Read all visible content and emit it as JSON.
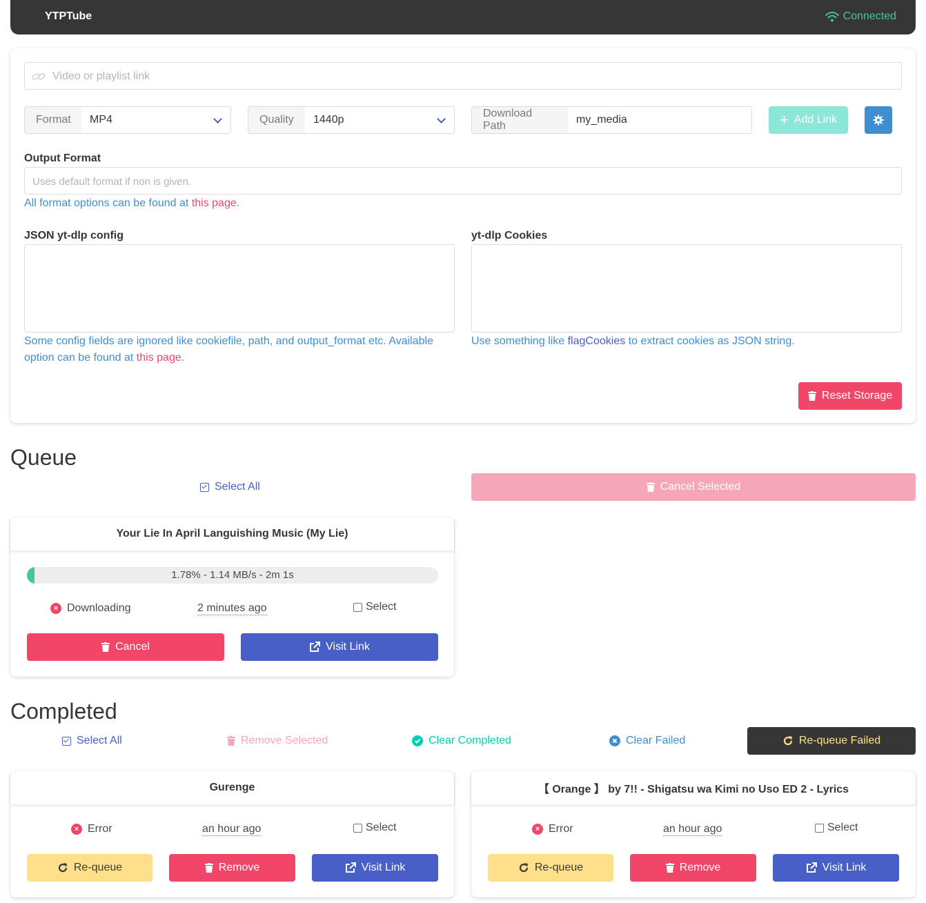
{
  "navbar": {
    "brand": "YTPTube",
    "status": "Connected"
  },
  "form": {
    "url_placeholder": "Video or playlist link",
    "format_label": "Format",
    "format_value": "MP4",
    "quality_label": "Quality",
    "quality_value": "1440p",
    "path_label": "Download Path",
    "path_value": "my_media",
    "add_label": "Add Link",
    "output_label": "Output Format",
    "output_placeholder": "Uses default format if non is given.",
    "output_help_prefix": "All format options can be found at ",
    "output_help_link": "this page",
    "output_help_suffix": ".",
    "config_label": "JSON yt-dlp config",
    "config_help_prefix": "Some config fields are ignored like cookiefile, path, and output_format etc. Available option can be found at ",
    "config_help_link": "this page",
    "config_help_suffix": ".",
    "cookies_label": "yt-dlp Cookies",
    "cookies_help_prefix": "Use something like ",
    "cookies_help_link": "flagCookies",
    "cookies_help_suffix": " to extract cookies as JSON string.",
    "reset_label": "Reset Storage"
  },
  "queue": {
    "title": "Queue",
    "select_all": "Select All",
    "cancel_selected": "Cancel Selected",
    "items": [
      {
        "title": "Your Lie In April Languishing Music (My Lie)",
        "progress": 1.78,
        "progress_text": "1.78% - 1.14 MB/s - 2m 1s",
        "status": "Downloading",
        "time": "2 minutes ago",
        "select": "Select",
        "cancel": "Cancel",
        "visit": "Visit Link"
      }
    ]
  },
  "completed": {
    "title": "Completed",
    "select_all": "Select All",
    "remove_selected": "Remove Selected",
    "clear_completed": "Clear Completed",
    "clear_failed": "Clear Failed",
    "requeue_failed": "Re-queue Failed",
    "items": [
      {
        "title": "Gurenge",
        "status": "Error",
        "time": "an hour ago",
        "select": "Select",
        "requeue": "Re-queue",
        "remove": "Remove",
        "visit": "Visit Link"
      },
      {
        "title": "【 Orange 】 by 7!! - Shigatsu wa Kimi no Uso ED 2 - Lyrics",
        "status": "Error",
        "time": "an hour ago",
        "select": "Select",
        "requeue": "Re-queue",
        "remove": "Remove",
        "visit": "Visit Link"
      }
    ]
  },
  "colors": {
    "danger": "#f14668",
    "link": "#485fc7",
    "success": "#48c78e",
    "warning": "#ffe08a",
    "dark": "#363636",
    "info": "#3e8ed0"
  }
}
